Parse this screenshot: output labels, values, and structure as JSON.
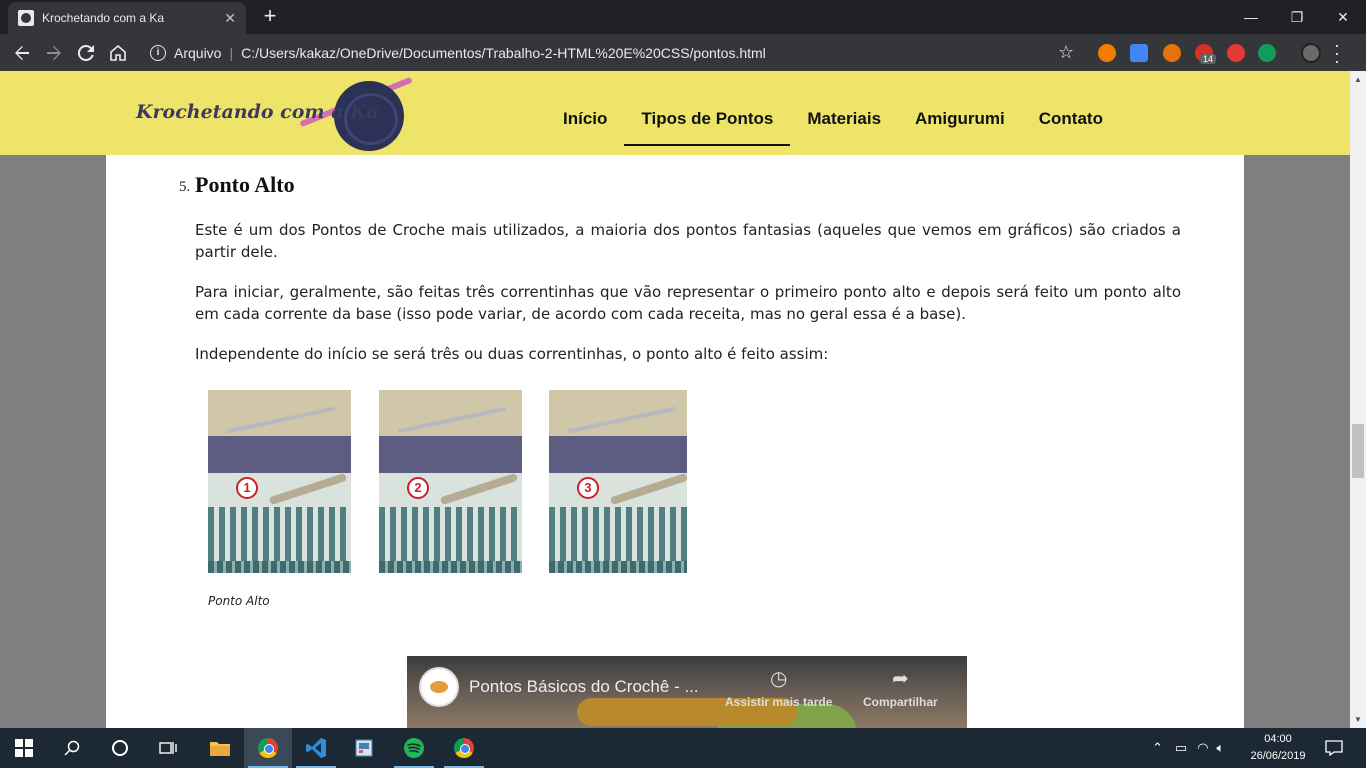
{
  "browser": {
    "tab_title": "Krochetando com a Ka",
    "tab_close": "✕",
    "new_tab": "+",
    "window_controls": {
      "minimize": "—",
      "maximize": "❐",
      "close": "✕"
    },
    "address_prefix": "Arquivo",
    "address_url": "C:/Users/kakaz/OneDrive/Documentos/Trabalho-2-HTML%20E%20CSS/pontos.html",
    "extension_badge": "14",
    "extensions": [
      {
        "name": "play-icon",
        "color": "#f57c00"
      },
      {
        "name": "translate-icon",
        "color": "#4285f4"
      },
      {
        "name": "fire-icon",
        "color": "#e8710a"
      },
      {
        "name": "notification-icon",
        "color": "#d93025"
      },
      {
        "name": "youtube-icon",
        "color": "#e53935"
      },
      {
        "name": "chat-icon",
        "color": "#0f9d58"
      }
    ]
  },
  "site": {
    "logo_text": "Krochetando com a Ka",
    "nav": [
      "Início",
      "Tipos de Pontos",
      "Materiais",
      "Amigurumi",
      "Contato"
    ],
    "active_nav": "Tipos de Pontos"
  },
  "article": {
    "item_number": "5.",
    "heading": "Ponto Alto",
    "paragraphs": [
      "Este é um dos Pontos de Croche mais utilizados, a maioria dos pontos fantasias (aqueles que vemos em gráficos) são criados a partir dele.",
      "Para iniciar, geralmente, são feitas três correntinhas que vão representar o primeiro ponto alto e depois será feito um ponto alto em cada corrente da base (isso pode variar, de acordo com cada receita, mas no geral essa é a base).",
      "Independente do início se será três ou duas correntinhas, o ponto alto é feito assim:"
    ],
    "figure_steps": [
      "1",
      "2",
      "3"
    ],
    "caption": "Ponto Alto"
  },
  "video": {
    "title": "Pontos Básicos do Crochê - ...",
    "watch_later": "Assistir mais tarde",
    "share": "Compartilhar"
  },
  "taskbar": {
    "apps": [
      {
        "name": "search-icon",
        "glyph": "⚲"
      },
      {
        "name": "cortana-icon",
        "glyph": "○"
      },
      {
        "name": "task-view-icon",
        "glyph": "⧉"
      },
      {
        "name": "file-explorer-icon",
        "glyph": "▬"
      },
      {
        "name": "chrome-icon",
        "glyph": ""
      },
      {
        "name": "vscode-icon",
        "glyph": "❮❯"
      },
      {
        "name": "paint-icon",
        "glyph": "▣"
      },
      {
        "name": "spotify-icon",
        "glyph": "◉"
      },
      {
        "name": "chrome-icon-2",
        "glyph": ""
      }
    ],
    "time": "04:00",
    "date": "26/06/2019"
  }
}
